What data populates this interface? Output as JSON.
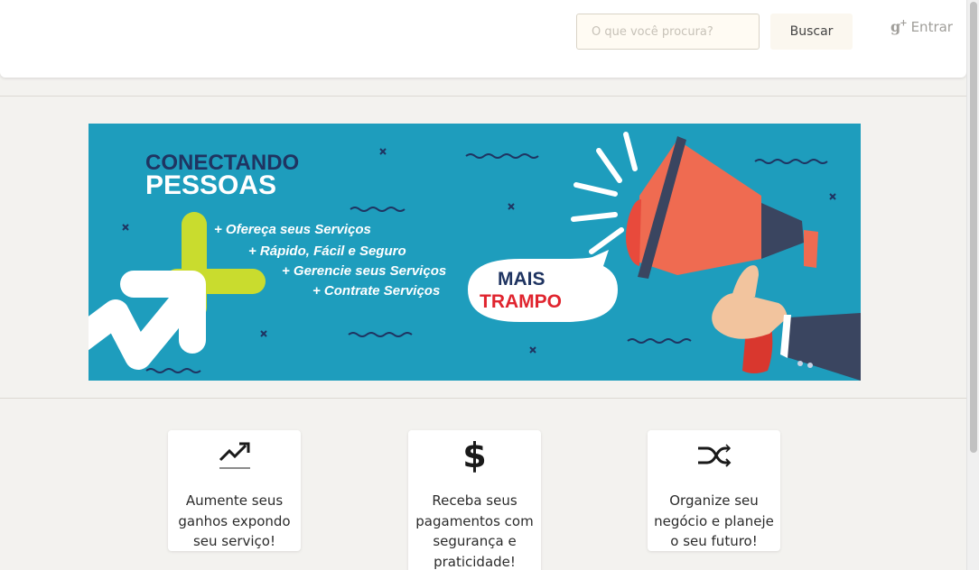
{
  "header": {
    "search_placeholder": "O que você procura?",
    "search_button": "Buscar",
    "login_label": "Entrar",
    "login_icon": "google-plus-icon"
  },
  "banner": {
    "title_line1": "CONECTANDO",
    "title_line2": "PESSOAS",
    "bullets": [
      "+ Ofereça seus Serviços",
      "+ Rápido, Fácil e Seguro",
      "+ Gerencie seus Serviços",
      "+ Contrate Serviços"
    ],
    "bubble_line1": "MAIS",
    "bubble_line2": "TRAMPO",
    "colors": {
      "background": "#1e9dbd",
      "navy": "#1f3461",
      "red": "#e0242e",
      "lime": "#c9dc2e",
      "megaphone": "#ef6b51"
    }
  },
  "features": [
    {
      "icon": "trending-up-icon",
      "text": "Aumente seus ganhos expondo seu serviço!"
    },
    {
      "icon": "dollar-icon",
      "text": "Receba seus pagamentos com segurança e praticidade!"
    },
    {
      "icon": "shuffle-icon",
      "text": "Organize seu negócio e planeje o seu futuro!"
    }
  ]
}
